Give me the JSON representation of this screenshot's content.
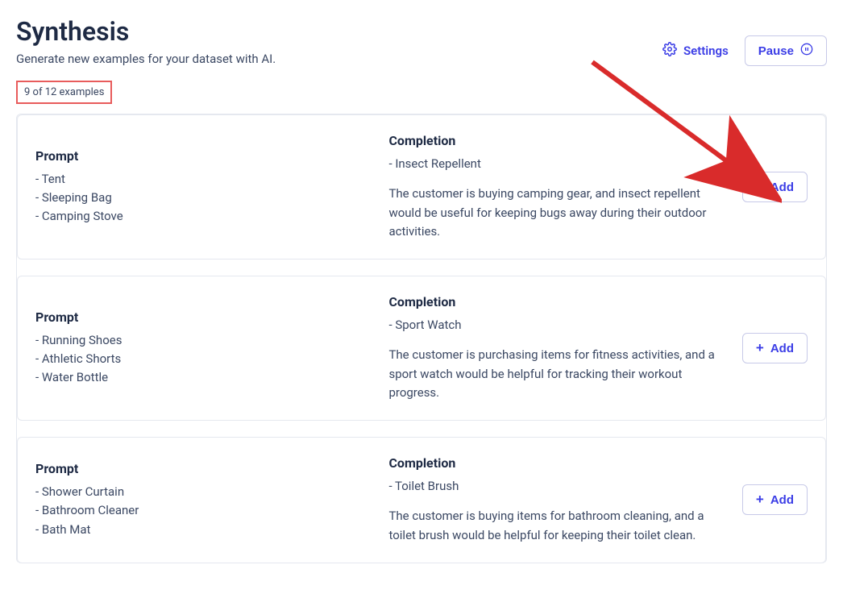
{
  "header": {
    "title": "Synthesis",
    "subtitle": "Generate new examples for your dataset with AI.",
    "settings_label": "Settings",
    "pause_label": "Pause"
  },
  "counter_text": "9 of 12 examples",
  "labels": {
    "prompt": "Prompt",
    "completion": "Completion",
    "add": "Add"
  },
  "examples": [
    {
      "prompt_items": [
        "Tent",
        "Sleeping Bag",
        "Camping Stove"
      ],
      "completion_items": [
        "Insect Repellent"
      ],
      "description": "The customer is buying camping gear, and insect repellent would be useful for keeping bugs away during their outdoor activities."
    },
    {
      "prompt_items": [
        "Running Shoes",
        "Athletic Shorts",
        "Water Bottle"
      ],
      "completion_items": [
        "Sport Watch"
      ],
      "description": "The customer is purchasing items for fitness activities, and a sport watch would be helpful for tracking their workout progress."
    },
    {
      "prompt_items": [
        "Shower Curtain",
        "Bathroom Cleaner",
        "Bath Mat"
      ],
      "completion_items": [
        "Toilet Brush"
      ],
      "description": "The customer is buying items for bathroom cleaning, and a toilet brush would be helpful for keeping their toilet clean."
    }
  ]
}
